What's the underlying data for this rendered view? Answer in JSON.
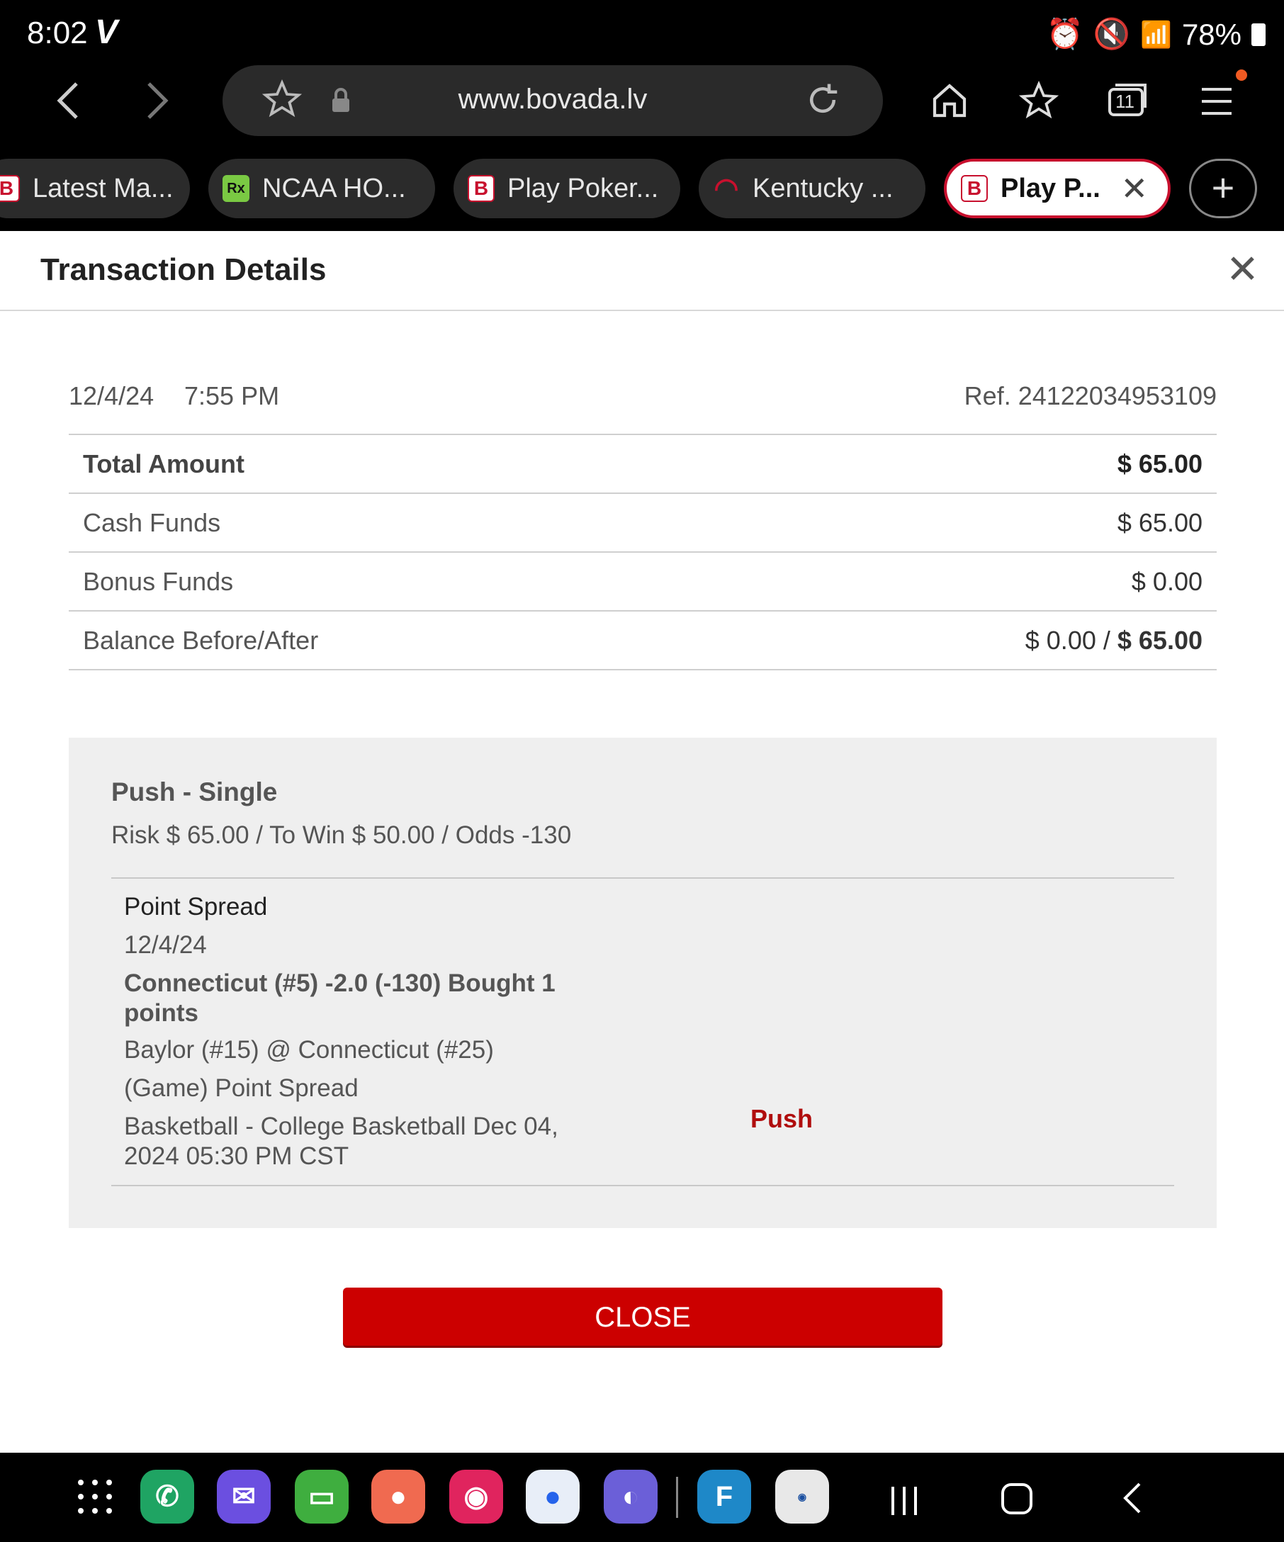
{
  "status_bar": {
    "time": "8:02",
    "carrier_logo": "V",
    "battery": "78%"
  },
  "browser": {
    "url": "www.bovada.lv",
    "tabs": [
      {
        "label": "Latest Ma...",
        "favicon": "B"
      },
      {
        "label": "NCAA HO...",
        "favicon": "Rx"
      },
      {
        "label": "Play Poker...",
        "favicon": "B"
      },
      {
        "label": "Kentucky ...",
        "favicon": "kentucky-icon"
      },
      {
        "label": "Play P...",
        "favicon": "B",
        "active": true
      }
    ],
    "tab_count": "11"
  },
  "dialog": {
    "title": "Transaction Details",
    "date": "12/4/24",
    "time": "7:55 PM",
    "reference": "Ref. 24122034953109",
    "summary": {
      "total_label": "Total Amount",
      "total_value": "$ 65.00",
      "cash_label": "Cash Funds",
      "cash_value": "$ 65.00",
      "bonus_label": "Bonus Funds",
      "bonus_value": "$ 0.00",
      "balance_label": "Balance Before/After",
      "balance_before": "$ 0.00 /",
      "balance_after": "$ 65.00"
    },
    "bet": {
      "title": "Push - Single",
      "risk_line": "Risk $ 65.00 / To Win $ 50.00 / Odds -130",
      "market": "Point Spread",
      "date": "12/4/24",
      "pick": "Connecticut (#5) -2.0 (-130) Bought 1 points",
      "matchup": "Baylor (#15) @ Connecticut (#25)",
      "bet_type": "(Game) Point Spread",
      "event": "Basketball - College Basketball Dec 04, 2024 05:30 PM CST",
      "result": "Push"
    },
    "close_button": "CLOSE"
  },
  "colors": {
    "brand_red": "#cc0000",
    "push_red": "#b00d0d",
    "panel_bg": "#efefef"
  }
}
